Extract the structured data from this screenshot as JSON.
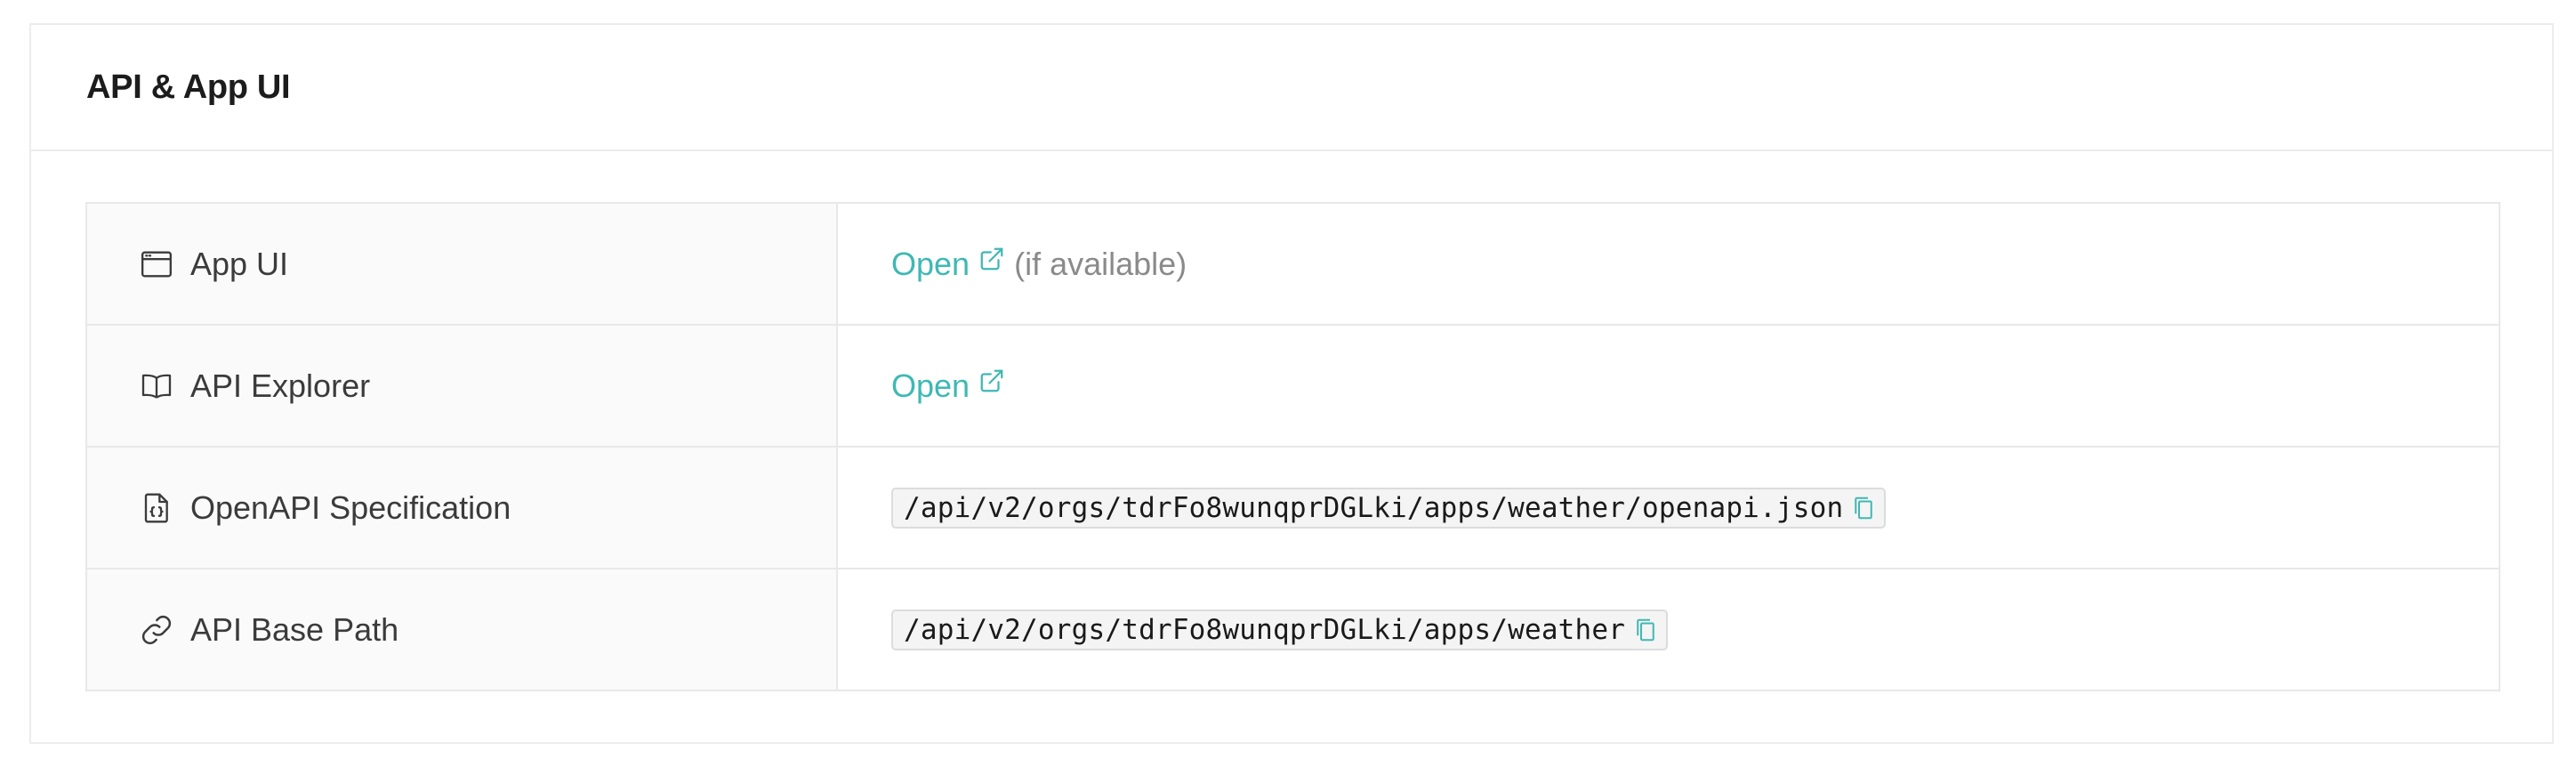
{
  "card": {
    "title": "API & App UI"
  },
  "rows": [
    {
      "label": "App UI",
      "icon": "browser-window-icon",
      "link_label": "Open",
      "hint": "(if available)"
    },
    {
      "label": "API Explorer",
      "icon": "open-book-icon",
      "link_label": "Open"
    },
    {
      "label": "OpenAPI Specification",
      "icon": "code-file-icon",
      "code": "/api/v2/orgs/tdrFo8wunqprDGLki/apps/weather/openapi.json"
    },
    {
      "label": "API Base Path",
      "icon": "link-icon",
      "code": "/api/v2/orgs/tdrFo8wunqprDGLki/apps/weather"
    }
  ],
  "colors": {
    "accent": "#3fb8b3",
    "label_bg": "#fafafa",
    "border": "#e8e8e8",
    "hint": "#8a8a8a"
  }
}
